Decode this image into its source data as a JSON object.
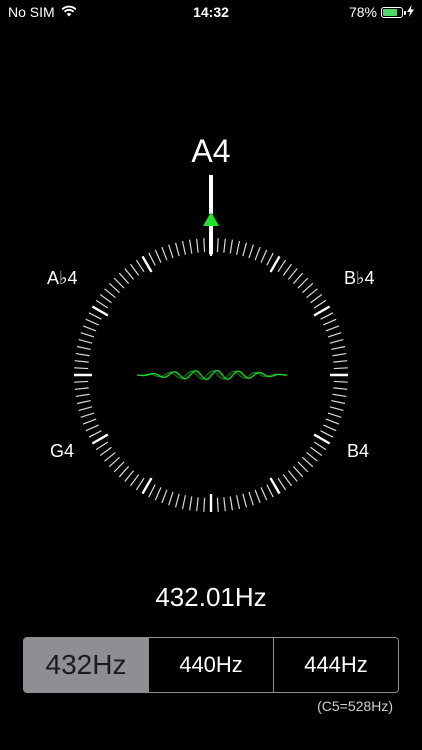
{
  "status_bar": {
    "carrier": "No SIM",
    "time": "14:32",
    "battery_percent": "78%",
    "battery_level": 0.78,
    "icons": [
      "wifi-icon",
      "battery-icon",
      "charging-bolt-icon"
    ]
  },
  "tuner": {
    "current_note": "A4",
    "left_upper_note": "A♭4",
    "right_upper_note": "B♭4",
    "left_lower_note": "G4",
    "right_lower_note": "B4",
    "frequency": "432.01Hz",
    "accent_color": "#23e02a"
  },
  "reference": {
    "options": [
      {
        "label": "432Hz",
        "selected": true
      },
      {
        "label": "440Hz",
        "selected": false
      },
      {
        "label": "444Hz",
        "selected": false
      }
    ],
    "note": "(C5=528Hz)"
  }
}
